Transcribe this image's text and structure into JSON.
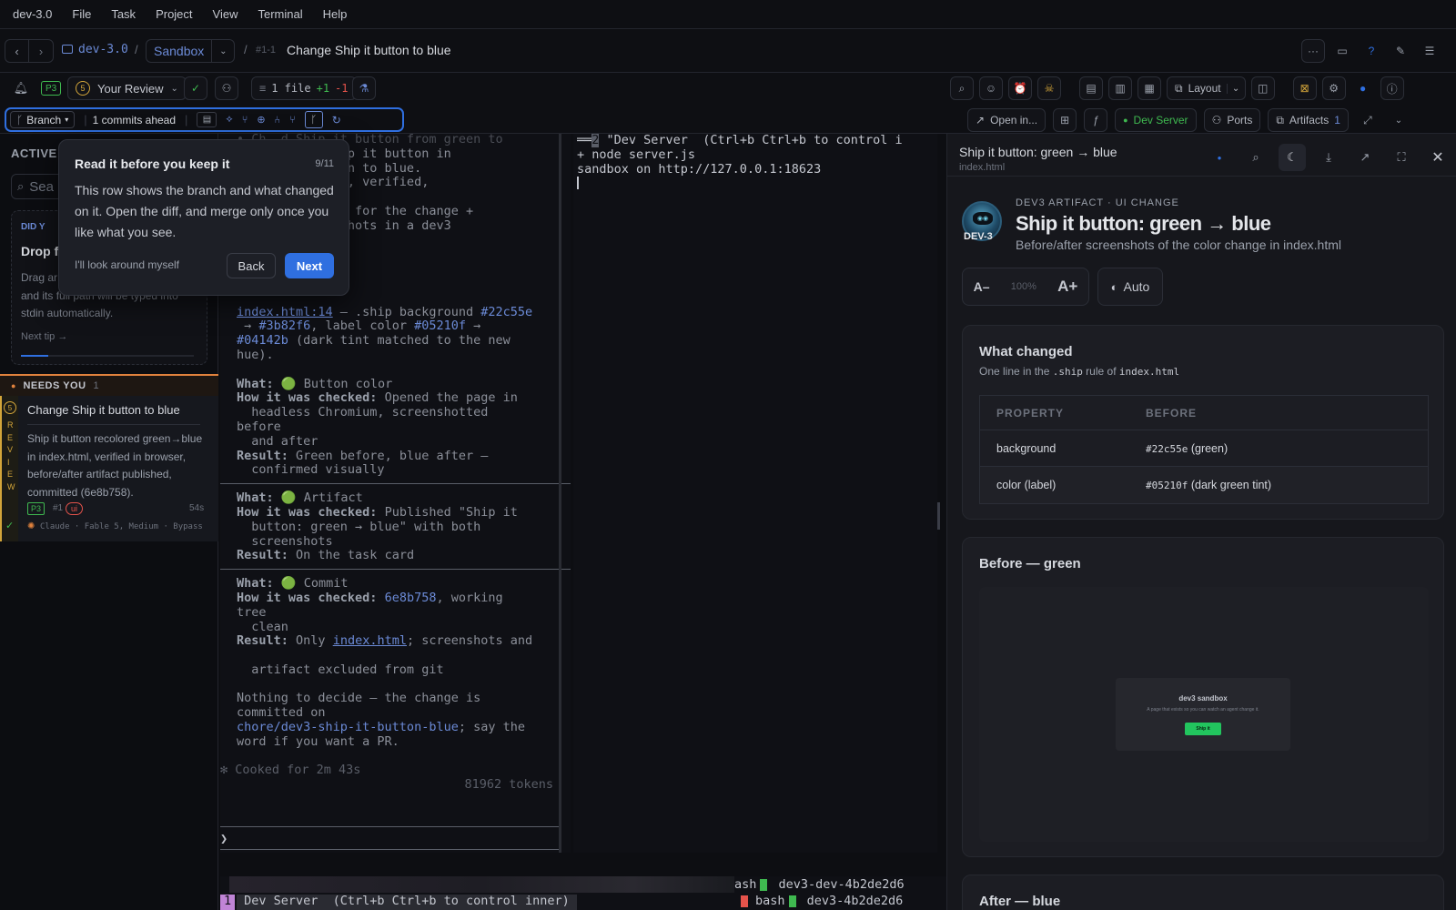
{
  "menubar": {
    "app": "dev-3.0",
    "items": [
      "File",
      "Task",
      "Project",
      "View",
      "Terminal",
      "Help"
    ]
  },
  "titlebar": {
    "project": "dev-3.0",
    "env": "Sandbox",
    "task_id": "#1-1",
    "task_title": "Change Ship it button to blue"
  },
  "toolrow": {
    "priority": "P3",
    "review_count": "5",
    "review_label": "Your Review",
    "files": "1 file",
    "plus": "+1",
    "minus": "-1",
    "layout_label": "Layout"
  },
  "branchrow": {
    "branch_label": "Branch",
    "ahead": "1 commits ahead",
    "open_in": "Open in...",
    "dev_server": "Dev Server",
    "ports": "Ports",
    "artifacts": "Artifacts",
    "artifacts_count": "1"
  },
  "sidebar": {
    "active_label": "ACTIVE",
    "search_placeholder": "Sea",
    "tip_label": "DID Y",
    "tip_title": "Drop f",
    "tip_body1": "Drag ar",
    "tip_body2": "and its full path will be typed into",
    "tip_body3": "stdin automatically.",
    "next_tip": "Next tip →",
    "needs_label": "NEEDS YOU",
    "needs_count": "1",
    "task_title": "Change Ship it button to blue",
    "task_desc": "Ship it button recolored green→blue in index.html, verified in browser, before/after artifact published, committed (6e8b758).",
    "review_vertical": "REVIEW",
    "task_priority": "P3",
    "task_num": "#1",
    "task_tag": "ui",
    "task_time": "54s",
    "task_agent": "Claude · Fable 5, Medium · Bypass",
    "task_count": "5"
  },
  "terminal_left": {
    "l0": "• Ch  d Ship it button from green to",
    "l1": "        the Ship it button in",
    "l2": "        om green to blue.",
    "l3": "        d: done, verified,",
    "l4": "        u asked for the change +",
    "l5": "        screenshots in a dev3",
    "l6": "        commit.",
    "l7": "        lt.",
    "what_changed": "What changed",
    "d_file": "index.html:14",
    "d_a": " — .ship background ",
    "d_c1": "#22c55e",
    "d_arrow1": " → ",
    "d_c2": "#3b82f6",
    "d_b": ", label color ",
    "d_c3": "#05210f",
    "d_arrow2": " →",
    "d_c4": "#04142b",
    "d_tail": " (dark tint matched to the new",
    "d_hue": "hue).",
    "v1_what": "What:",
    "v1_name": " 🟢 Button color",
    "v1_how": "How it was checked:",
    "v1_how_t": " Opened the page in",
    "v1_how2": "  headless Chromium, screenshotted",
    "v1_how3": "before",
    "v1_how4": "  and after",
    "v1_res": "Result:",
    "v1_res_t": " Green before, blue after —",
    "v1_res2": "  confirmed visually",
    "v2_name": " 🟢 Artifact",
    "v2_how_t": " Published \"Ship it",
    "v2_how2": "  button: green → blue\" with both",
    "v2_how3": "  screenshots",
    "v2_res_t": " On the task card",
    "v3_name": " 🟢 Commit",
    "v3_hash": "6e8b758",
    "v3_how_t": ", working",
    "v3_how2": "tree",
    "v3_how3": "  clean",
    "v3_res_a": " Only ",
    "v3_res_file": "index.html",
    "v3_res_b": "; screenshots and",
    "v3_res2": "  artifact excluded from git",
    "n1": "Nothing to decide — the change is",
    "n2": "committed on",
    "n3_branch": "chore/dev3-ship-it-button-blue",
    "n3_tail": "; say the",
    "n4": "word if you want a PR.",
    "cooked": "✻ Cooked for 2m 43s",
    "tokens": "81962 tokens",
    "prompt": "❯"
  },
  "terminal_right": {
    "l1_num": "2",
    "l1": " \"Dev Server  (Ctrl+b Ctrl+b to control i",
    "l2": "+ node server.js",
    "l3": "sandbox on http://127.0.0.1:18623",
    "status1": "ash",
    "status1b": " dev3-dev-4b2de2d6",
    "status2": "bash",
    "status2b": " dev3-4b2de2d6",
    "status_left_num": "1",
    "status_left": " Dev Server  (Ctrl+b Ctrl+b to control inner)"
  },
  "tour": {
    "title": "Read it before you keep it",
    "step": "9/11",
    "body": "This row shows the branch and what changed on it. Open the diff, and merge only once you like what you see.",
    "skip": "I'll look around myself",
    "back": "Back",
    "next": "Next"
  },
  "panel": {
    "title": "Ship it button: green → blue",
    "file": "index.html",
    "eyebrow": "DEV3 ARTIFACT · UI CHANGE",
    "h1": "Ship it button: green → blue",
    "sub": "Before/after screenshots of the color change in index.html",
    "logo_text": "DEV-3",
    "font_minus": "A–",
    "zoom": "100%",
    "font_plus": "A+",
    "theme": "Auto",
    "changed_title": "What changed",
    "changed_sub_a": "One line in the ",
    "changed_sub_code1": ".ship",
    "changed_sub_b": " rule of ",
    "changed_sub_code2": "index.html",
    "table_headers": [
      "PROPERTY",
      "BEFORE"
    ],
    "rows": [
      {
        "prop": "background",
        "code": "#22c55e",
        "note": " (green)"
      },
      {
        "prop": "color (label)",
        "code": "#05210f",
        "note": " (dark green tint)"
      }
    ],
    "before_title": "Before — green",
    "shot_title": "dev3 sandbox",
    "shot_sub": "A page that exists so you can watch an agent change it.",
    "shot_btn": "Ship it",
    "after_title": "After — blue"
  },
  "colors": {
    "accent": "#2f6fe0",
    "green": "#3fb950",
    "red": "#e5534b",
    "orange": "#e0823d"
  }
}
